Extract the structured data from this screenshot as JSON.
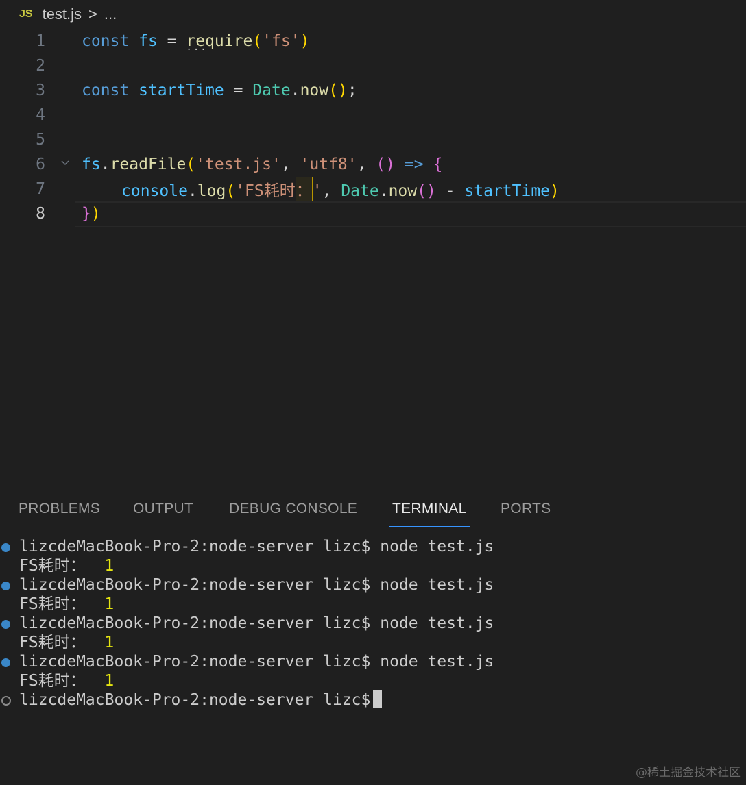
{
  "breadcrumb": {
    "file_badge": "JS",
    "file_name": "test.js",
    "separator": ">",
    "more": "..."
  },
  "editor": {
    "active_line": 8,
    "lines": [
      {
        "num": "1"
      },
      {
        "num": "2"
      },
      {
        "num": "3"
      },
      {
        "num": "4"
      },
      {
        "num": "5"
      },
      {
        "num": "6"
      },
      {
        "num": "7"
      },
      {
        "num": "8"
      }
    ],
    "tokens": {
      "l1_const": "const",
      "l1_fs": "fs",
      "l1_eq": "=",
      "l1_require": "require",
      "l1_paren_open": "(",
      "l1_str": "'fs'",
      "l1_paren_close": ")",
      "l3_const": "const",
      "l3_var": "startTime",
      "l3_eq": "=",
      "l3_date": "Date",
      "l3_dot": ".",
      "l3_now": "now",
      "l3_parens": "()",
      "l3_semi": ";",
      "l6_fs": "fs",
      "l6_dot": ".",
      "l6_readfile": "readFile",
      "l6_paren_open": "(",
      "l6_str1": "'test.js'",
      "l6_comma1": ",",
      "l6_str2": "'utf8'",
      "l6_comma2": ",",
      "l6_arrow_parens": "()",
      "l6_arrow": "=>",
      "l6_brace_open": "{",
      "l7_console": "console",
      "l7_dot1": ".",
      "l7_log": "log",
      "l7_paren_open": "(",
      "l7_str_pre": "'FS耗时",
      "l7_str_colon": "：",
      "l7_str_end": "'",
      "l7_comma": ",",
      "l7_date": "Date",
      "l7_dot2": ".",
      "l7_now": "now",
      "l7_parens": "()",
      "l7_minus": "-",
      "l7_var": "startTime",
      "l7_paren_close": ")",
      "l8_brace_close": "}",
      "l8_paren_close": ")"
    }
  },
  "panel": {
    "tabs": [
      {
        "label": "PROBLEMS"
      },
      {
        "label": "OUTPUT"
      },
      {
        "label": "DEBUG CONSOLE"
      },
      {
        "label": "TERMINAL"
      },
      {
        "label": "PORTS"
      }
    ],
    "active_tab": "TERMINAL"
  },
  "terminal": {
    "prompt": "lizcdeMacBook-Pro-2:node-server lizc$",
    "command": "node test.js",
    "output_label": "FS耗时：",
    "output_value": "1"
  },
  "watermark": "@稀土掘金技术社区"
}
